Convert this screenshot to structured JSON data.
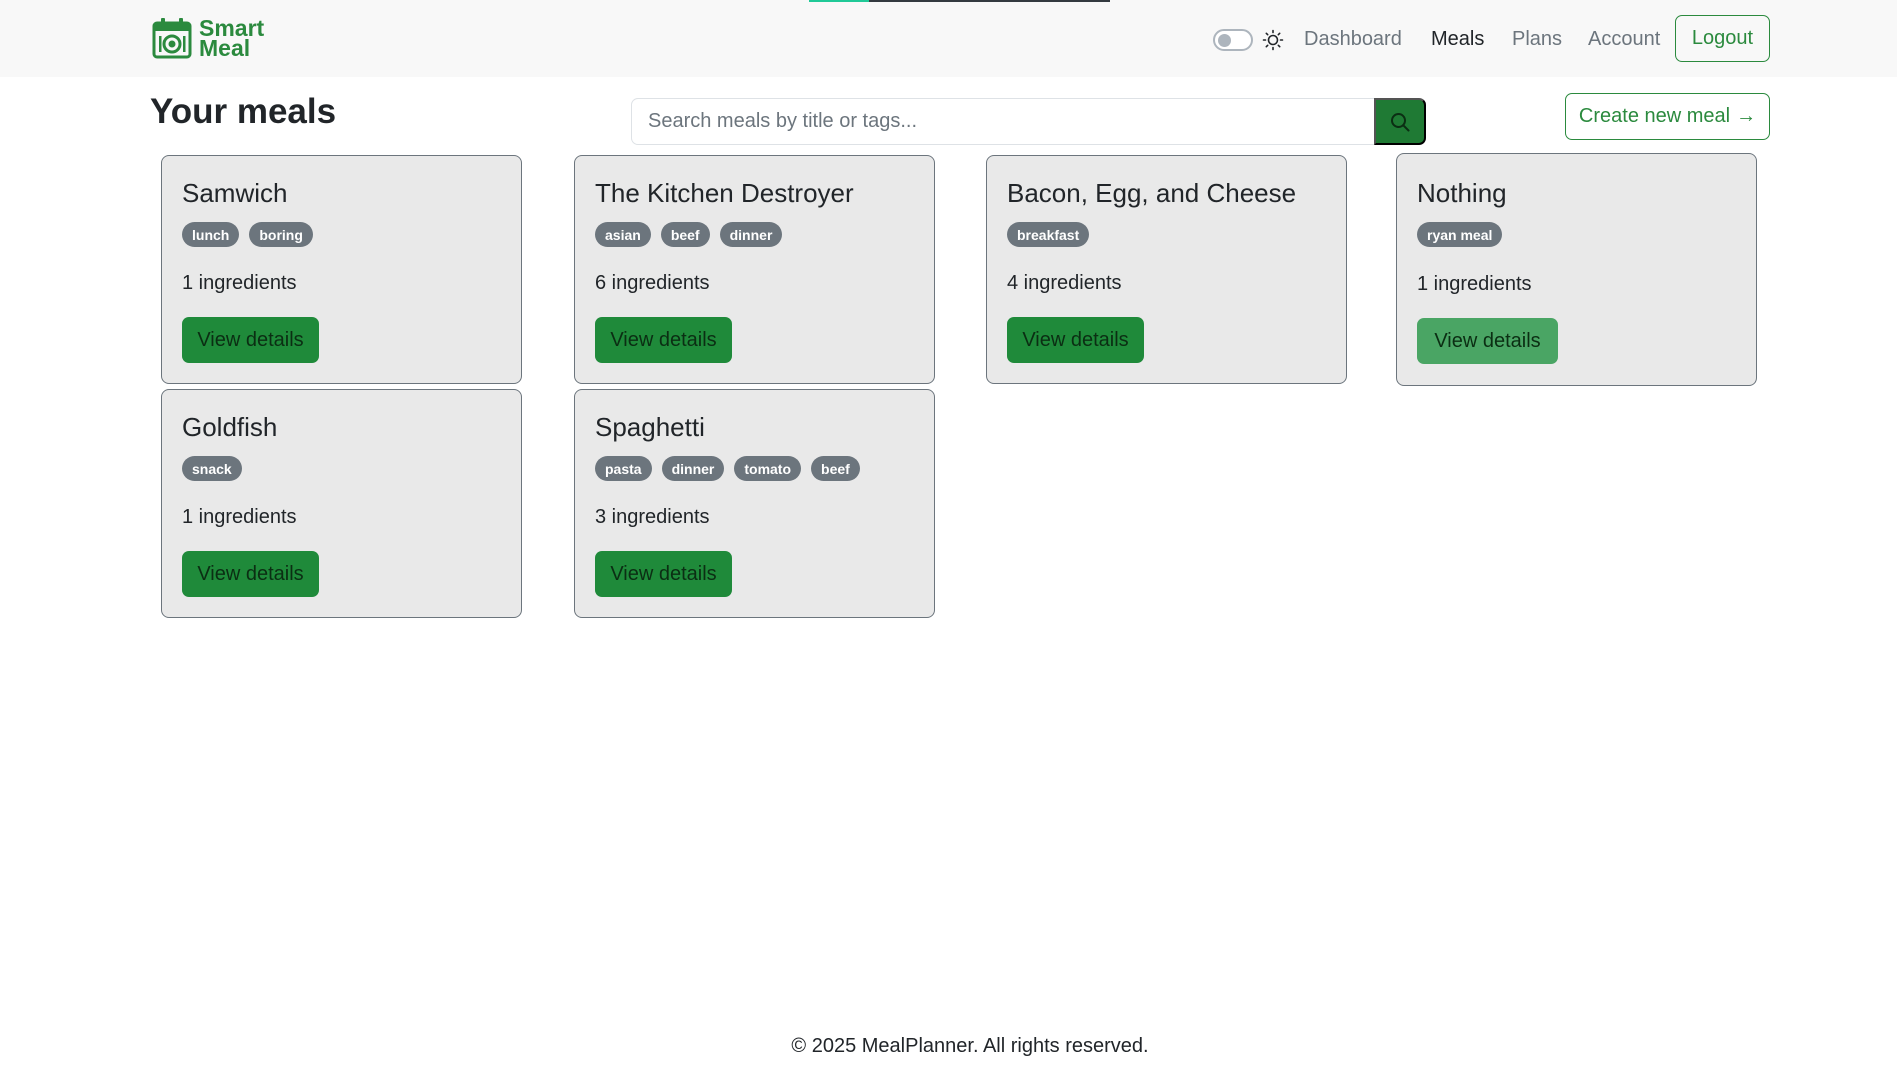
{
  "brand": {
    "line1": "Smart",
    "line2": "Meal",
    "icon": "calendar-plate-icon",
    "color": "#2b8a3e"
  },
  "nav": {
    "links": [
      {
        "label": "Dashboard",
        "active": false
      },
      {
        "label": "Meals",
        "active": true
      },
      {
        "label": "Plans",
        "active": false
      },
      {
        "label": "Account",
        "active": false
      }
    ],
    "logout_label": "Logout",
    "theme_toggle": {
      "icon": "sun-icon",
      "on": false
    }
  },
  "main": {
    "title": "Your meals",
    "search": {
      "placeholder": "Search meals by title or tags...",
      "value": "",
      "button_icon": "search-icon"
    },
    "create_label": "Create new meal",
    "create_icon": "arrow-right-icon",
    "view_details_label": "View details",
    "meals": [
      {
        "title": "Samwich",
        "tags": [
          "lunch",
          "boring"
        ],
        "ingredients": "1 ingredients"
      },
      {
        "title": "The Kitchen Destroyer",
        "tags": [
          "asian",
          "beef",
          "dinner"
        ],
        "ingredients": "6 ingredients"
      },
      {
        "title": "Bacon, Egg, and Cheese",
        "tags": [
          "breakfast"
        ],
        "ingredients": "4 ingredients"
      },
      {
        "title": "Nothing",
        "tags": [
          "ryan meal"
        ],
        "ingredients": "1 ingredients"
      },
      {
        "title": "Goldfish",
        "tags": [
          "snack"
        ],
        "ingredients": "1 ingredients"
      },
      {
        "title": "Spaghetti",
        "tags": [
          "pasta",
          "dinner",
          "tomato",
          "beef"
        ],
        "ingredients": "3 ingredients"
      }
    ]
  },
  "footer": {
    "text": "© 2025 MealPlanner. All rights reserved."
  },
  "colors": {
    "accent": "#2b8a3e",
    "button": "#1f8a3a",
    "tag": "#6c757d",
    "card_bg": "#e9e9e9"
  }
}
